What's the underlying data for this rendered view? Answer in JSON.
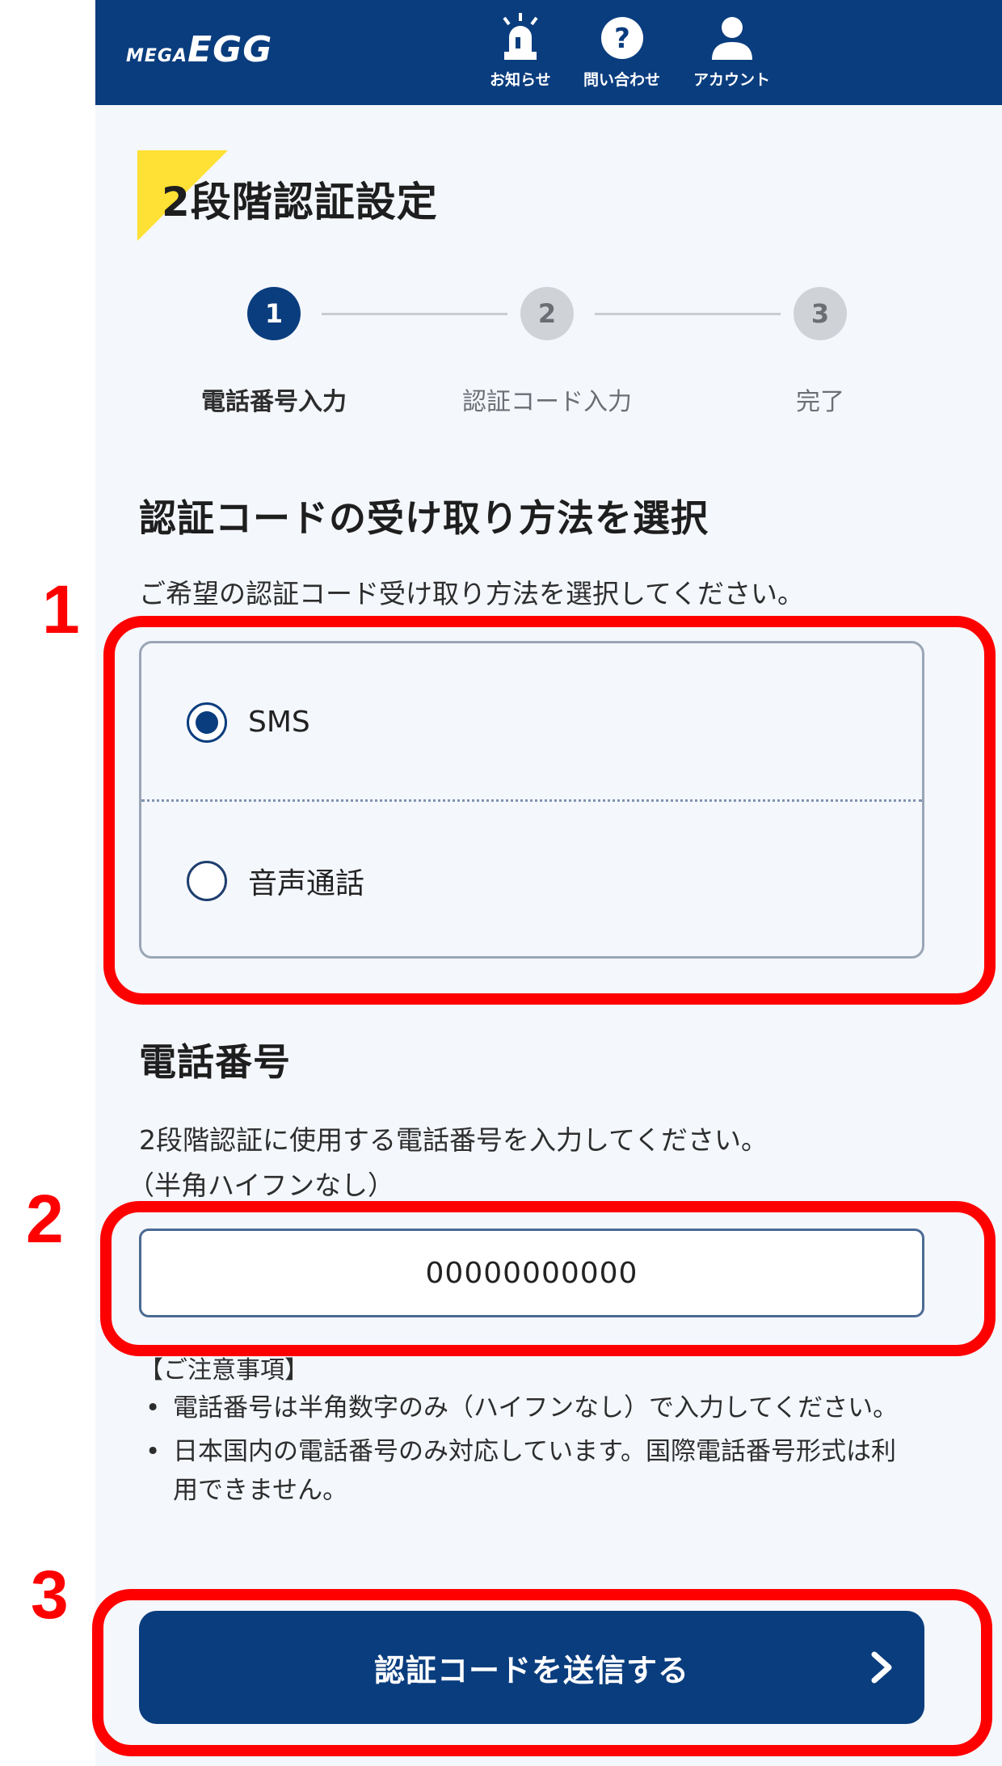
{
  "header": {
    "logo_mega": "MEGA",
    "logo_egg": "EGG",
    "nav": [
      {
        "label": "お知らせ",
        "icon": "siren-icon"
      },
      {
        "label": "問い合わせ",
        "icon": "question-icon"
      },
      {
        "label": "アカウント",
        "icon": "person-icon"
      }
    ]
  },
  "page": {
    "title": "2段階認証設定"
  },
  "stepper": {
    "current": 1,
    "steps": [
      {
        "number": "1",
        "label": "電話番号入力"
      },
      {
        "number": "2",
        "label": "認証コード入力"
      },
      {
        "number": "3",
        "label": "完了"
      }
    ]
  },
  "method": {
    "heading": "認証コードの受け取り方法を選択",
    "description": "ご希望の認証コード受け取り方法を選択してください。",
    "options": [
      {
        "label": "SMS",
        "selected": true
      },
      {
        "label": "音声通話",
        "selected": false
      }
    ]
  },
  "phone": {
    "heading": "電話番号",
    "description_line1": "2段階認証に使用する電話番号を入力してください。",
    "description_line2": "（半角ハイフンなし）",
    "value": "00000000000",
    "notes_heading": "【ご注意事項】",
    "notes": [
      "電話番号は半角数字のみ（ハイフンなし）で入力してください。",
      "日本国内の電話番号のみ対応しています。国際電話番号形式は利用できません。"
    ]
  },
  "submit": {
    "label": "認証コードを送信する"
  },
  "annotations": [
    "1",
    "2",
    "3"
  ],
  "colors": {
    "brand_navy": "#0a3d7e",
    "accent_yellow": "#ffe034",
    "annotation_red": "#ff0000",
    "background": "#f4f7fc"
  }
}
